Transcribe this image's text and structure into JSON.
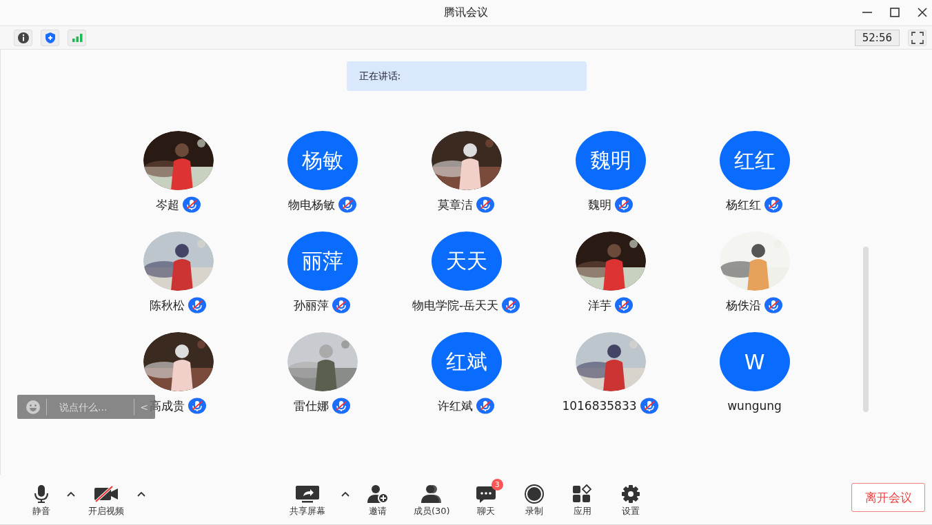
{
  "window": {
    "title": "腾讯会议"
  },
  "timer": "52:56",
  "speaking": {
    "label": "正在讲话:"
  },
  "participants": [
    {
      "name": "岑超",
      "muted": true
    },
    {
      "name": "物电杨敏",
      "kind": "initials",
      "initials": "杨敏",
      "muted": true
    },
    {
      "name": "莫章洁",
      "muted": true
    },
    {
      "name": "魏明",
      "kind": "initials",
      "initials": "魏明",
      "muted": true
    },
    {
      "name": "杨红红",
      "kind": "initials",
      "initials": "红红",
      "muted": true
    },
    {
      "name": "陈秋松",
      "muted": true
    },
    {
      "name": "孙丽萍",
      "kind": "initials",
      "initials": "丽萍",
      "muted": true
    },
    {
      "name": "物电学院-岳天天",
      "kind": "initials",
      "initials": "天天",
      "muted": true
    },
    {
      "name": "洋芋",
      "muted": true
    },
    {
      "name": "杨佚沿",
      "muted": true
    },
    {
      "name": "高成贵",
      "muted": true
    },
    {
      "name": "雷仕娜",
      "muted": true
    },
    {
      "name": "许红斌",
      "kind": "initials",
      "initials": "红斌",
      "muted": true
    },
    {
      "name": "1016835833",
      "muted": true
    },
    {
      "name": "wungung",
      "kind": "initials",
      "initials": "W",
      "muted": false
    }
  ],
  "chat_input": {
    "placeholder": "说点什么...",
    "collapse": "<"
  },
  "toolbar_left": [
    {
      "label": "静音",
      "kind": "mic",
      "has_menu": true
    },
    {
      "label": "开启视频",
      "kind": "camera",
      "has_menu": true
    }
  ],
  "toolbar_center": [
    {
      "label": "共享屏幕",
      "kind": "share",
      "has_menu": true
    },
    {
      "label": "邀请",
      "kind": "invite",
      "has_menu": false
    },
    {
      "label": "成员(30)",
      "kind": "members",
      "has_menu": false
    },
    {
      "label": "聊天",
      "kind": "chat",
      "has_menu": false,
      "badge": "3"
    },
    {
      "label": "录制",
      "kind": "record",
      "has_menu": false
    },
    {
      "label": "应用",
      "kind": "apps",
      "has_menu": false
    },
    {
      "label": "设置",
      "kind": "settings",
      "has_menu": false
    }
  ],
  "leave_button": "离开会议"
}
